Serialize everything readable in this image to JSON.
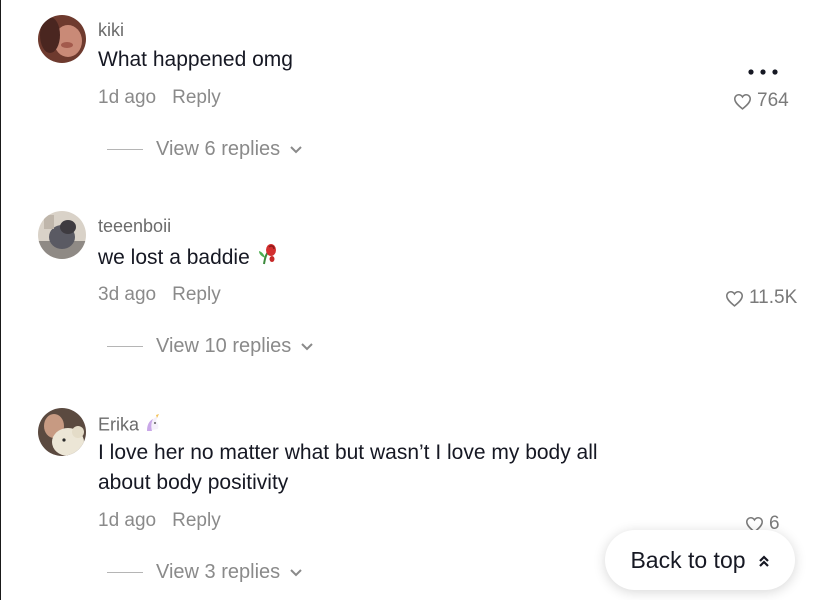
{
  "comments": [
    {
      "username": "kiki",
      "text": "What happened omg",
      "time": "1d ago",
      "reply_label": "Reply",
      "likes": "764",
      "view_replies": "View 6 replies",
      "avatar": "avatar-photo"
    },
    {
      "username": "teeenboii",
      "text": "we lost a baddie",
      "emoji": "wilted-rose-emoji",
      "time": "3d ago",
      "reply_label": "Reply",
      "likes": "11.5K",
      "view_replies": "View 10 replies",
      "avatar": "avatar-photo"
    },
    {
      "username": "Erika",
      "username_emoji": "unicorn-emoji",
      "text_line1": "I love her no matter what but wasn’t I love my body all",
      "text_line2": "about body positivity",
      "time": "1d ago",
      "reply_label": "Reply",
      "likes": "6",
      "view_replies": "View 3 replies",
      "avatar": "avatar-photo"
    }
  ],
  "more_menu": "more-options-icon",
  "back_to_top": {
    "label": "Back to top",
    "icon": "double-chevron-up-icon"
  },
  "colors": {
    "primary_text": "#161823",
    "secondary_text": "#8a8a8a",
    "username": "#6b6b6b",
    "background": "#ffffff"
  }
}
